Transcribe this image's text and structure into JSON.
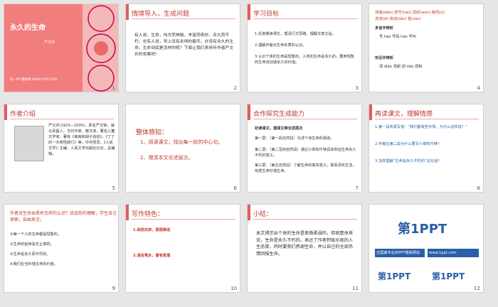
{
  "slides": [
    {
      "num": "1",
      "title": "永久的生命",
      "author": "严文井",
      "site": "第一PPT模板网-WWW.1PPT.COM"
    },
    {
      "num": "2",
      "header": "情境导入，生成问题",
      "text": "有人说，生命，伟大而神秘，丰富而奇妙，永久而不朽；也有人说，世上没有永恒的春天，亦没有永久的生命。生命到底是怎样的呢？下面让我们来听听作者严文井的答案吧！"
    },
    {
      "num": "3",
      "header": "学习目标",
      "items": [
        "1.反复朗读课文，理清行文思路，理解文章主旨。",
        "2.理解作者对生命本质的认识。",
        "3.认识个体的生命是短暂的，人类的生命是永久的，要用短暂的生命去创造永久的价值。"
      ]
    },
    {
      "num": "4",
      "line1": "凋谢(diāo)  怒号(háo)  冥顽(wán)  窥伺(sì)",
      "line2": "洗涤(dí)  收敛(liǎn)  暂(zàn)",
      "h1": "多音字辨析",
      "h2": "形近字辨析",
      "w1": "号  hào  号码  háo  号叫",
      "w2": "凋  diāo  凋谢  调  tiáo 调和"
    },
    {
      "num": "5",
      "header": "作者介绍",
      "bio1": "严文井(1915—2005)，原名严文锦，湖北武昌人，当代作家、散文家、著名儿童文学家，著有《南南和胡子伯伯》、《丁丁的一次奇怪旅行》等。中共党员，《人民文学》主编，人民文学出版社社长、总编辑。"
    },
    {
      "num": "6",
      "header": "整体感知：",
      "items": [
        "1、阅读课文，找出每一段的中心句。",
        "2、理清本文论述层次。"
      ]
    },
    {
      "num": "7",
      "header": "合作探究生成能力",
      "sub": "初读课文，理清文章论述层次",
      "items": [
        "第一层：（第一段自然段）论述个体生命的易逝。",
        "第二层：（第二至四自然段）通过小草和牛犊具体例证生命永久不朽的意义。",
        "第三层：（第五自然段）了解生命的真实意义，联系现实生活，热爱生命珍惜生命。"
      ]
    },
    {
      "num": "8",
      "header": "再读课文，理解情感",
      "q1": "1.第一段末尾写道：“我们都有些怜悯，为什么这样说？”",
      "q2": "2.作者在第二段为什么要写小草和牛犊？",
      "q3": "3.怎样理解“生命是永久不朽的”这句话？"
    },
    {
      "num": "9",
      "header": "作者对生命本质有怎样的认识？说说你的理解，学生自己探索，自由发言。",
      "items": [
        "①每一个人的生命都是短暂的。",
        "②生命的延续是无止境的。",
        "③生命是永久而不朽的。",
        "④我们应当珍惜生命的价值。"
      ]
    },
    {
      "num": "10",
      "header": "写作特色：",
      "p1": "1.欲扬先抑，层层推进",
      "p2": "2.语言隽永，富有哲理"
    },
    {
      "num": "11",
      "header": "小结：",
      "text": "本文揭示出个体的生命是卑微柔弱的，但就整体来说，生命是永久不朽的。表达了作者积极乐观的人生态度，同时要我们感谢生命，并以自己的全部热情回报生命。"
    },
    {
      "num": "12",
      "logo": "第1PPT",
      "line1": "全国最专业的PPT模板网站",
      "line2": "www.1ppt.com"
    }
  ],
  "colors": {
    "accent": "#c0392b",
    "pink": "#f17d7d",
    "blue": "#2a5fa8"
  }
}
